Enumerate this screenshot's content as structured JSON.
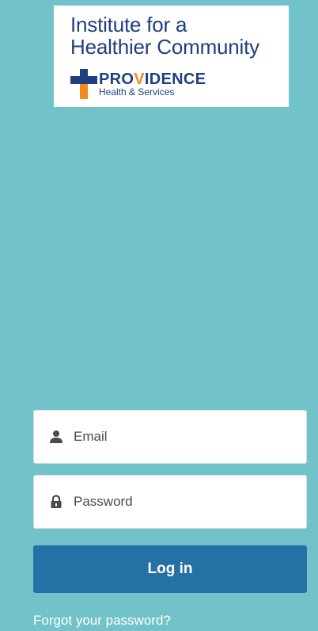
{
  "logo": {
    "line1": "Institute for a",
    "line2": "Healthier Community",
    "brand_name_main": "PRO",
    "brand_name_accent": "V",
    "brand_name_rest": "IDENCE",
    "brand_sub": "Health & Services",
    "icon": "providence-cross-icon",
    "colors": {
      "navy": "#1f3f7f",
      "orange": "#f28a1c"
    }
  },
  "form": {
    "email": {
      "placeholder": "Email",
      "value": "",
      "icon": "user-icon"
    },
    "password": {
      "placeholder": "Password",
      "value": "",
      "icon": "lock-icon"
    },
    "login_label": "Log in",
    "forgot_label": "Forgot your password?"
  },
  "colors": {
    "background": "#72c2c9",
    "button": "#2571a6",
    "field_bg": "#ffffff"
  }
}
